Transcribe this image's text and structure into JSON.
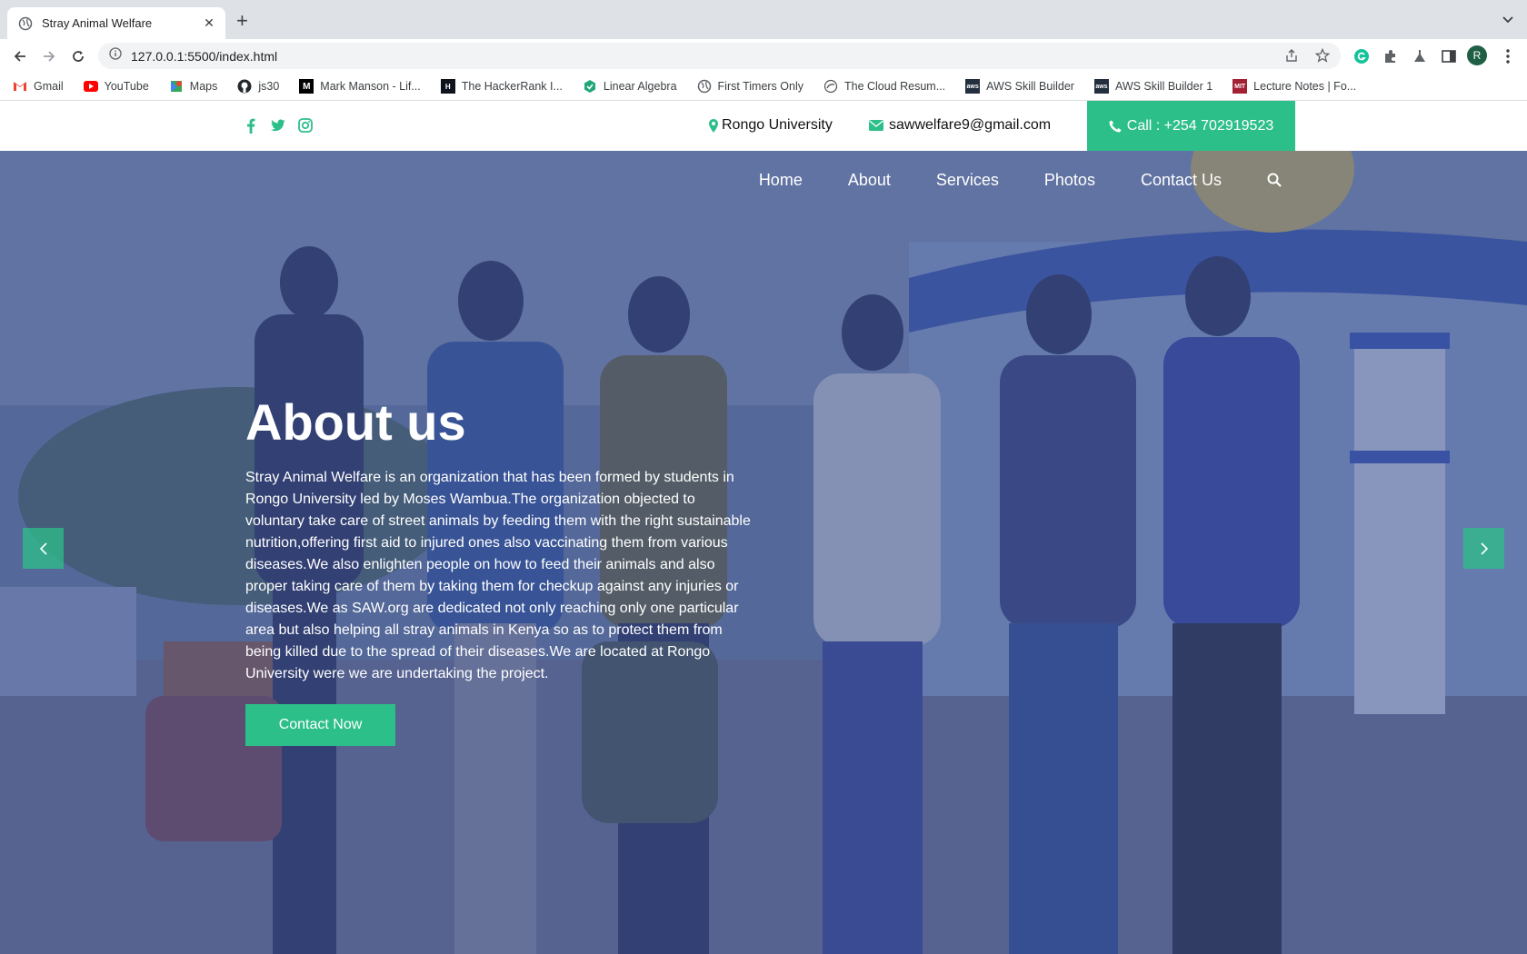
{
  "browser": {
    "tab_title": "Stray Animal Welfare",
    "url": "127.0.0.1:5500/index.html",
    "profile_initial": "R",
    "bookmarks": [
      {
        "label": "Gmail",
        "icon": "gmail-icon"
      },
      {
        "label": "YouTube",
        "icon": "youtube-icon"
      },
      {
        "label": "Maps",
        "icon": "maps-icon"
      },
      {
        "label": "js30",
        "icon": "github-icon"
      },
      {
        "label": "Mark Manson - Lif...",
        "icon": "medium-icon"
      },
      {
        "label": "The HackerRank I...",
        "icon": "hackerrank-icon"
      },
      {
        "label": "Linear Algebra",
        "icon": "hexagon-icon"
      },
      {
        "label": "First Timers Only",
        "icon": "globe-icon"
      },
      {
        "label": "The Cloud Resum...",
        "icon": "cloud-icon"
      },
      {
        "label": "AWS Skill Builder",
        "icon": "aws-icon"
      },
      {
        "label": "AWS Skill Builder 1",
        "icon": "aws-icon"
      },
      {
        "label": "Lecture Notes | Fo...",
        "icon": "mit-icon"
      }
    ]
  },
  "topbar": {
    "location": "Rongo University",
    "email": "sawwelfare9@gmail.com",
    "call": "Call : +254 702919523"
  },
  "nav": {
    "items": [
      "Home",
      "About",
      "Services",
      "Photos",
      "Contact Us"
    ]
  },
  "hero": {
    "title": "About us",
    "text": "Stray Animal Welfare is an organization that has been formed by students in Rongo University led by Moses Wambua.The organization objected to voluntary take care of street animals by feeding them with the right sustainable nutrition,offering first aid to injured ones also vaccinating them from various diseases.We also enlighten people on how to feed their animals and also proper taking care of them by taking them for checkup against any injuries or diseases.We as SAW.org are dedicated not only reaching only one particular area but also helping all stray animals in Kenya so as to protect them from being killed due to the spread of their diseases.We are located at Rongo University were we are undertaking the project.",
    "cta": "Contact Now"
  },
  "colors": {
    "accent": "#2dbf8a",
    "overlay": "#3a4e8c"
  }
}
